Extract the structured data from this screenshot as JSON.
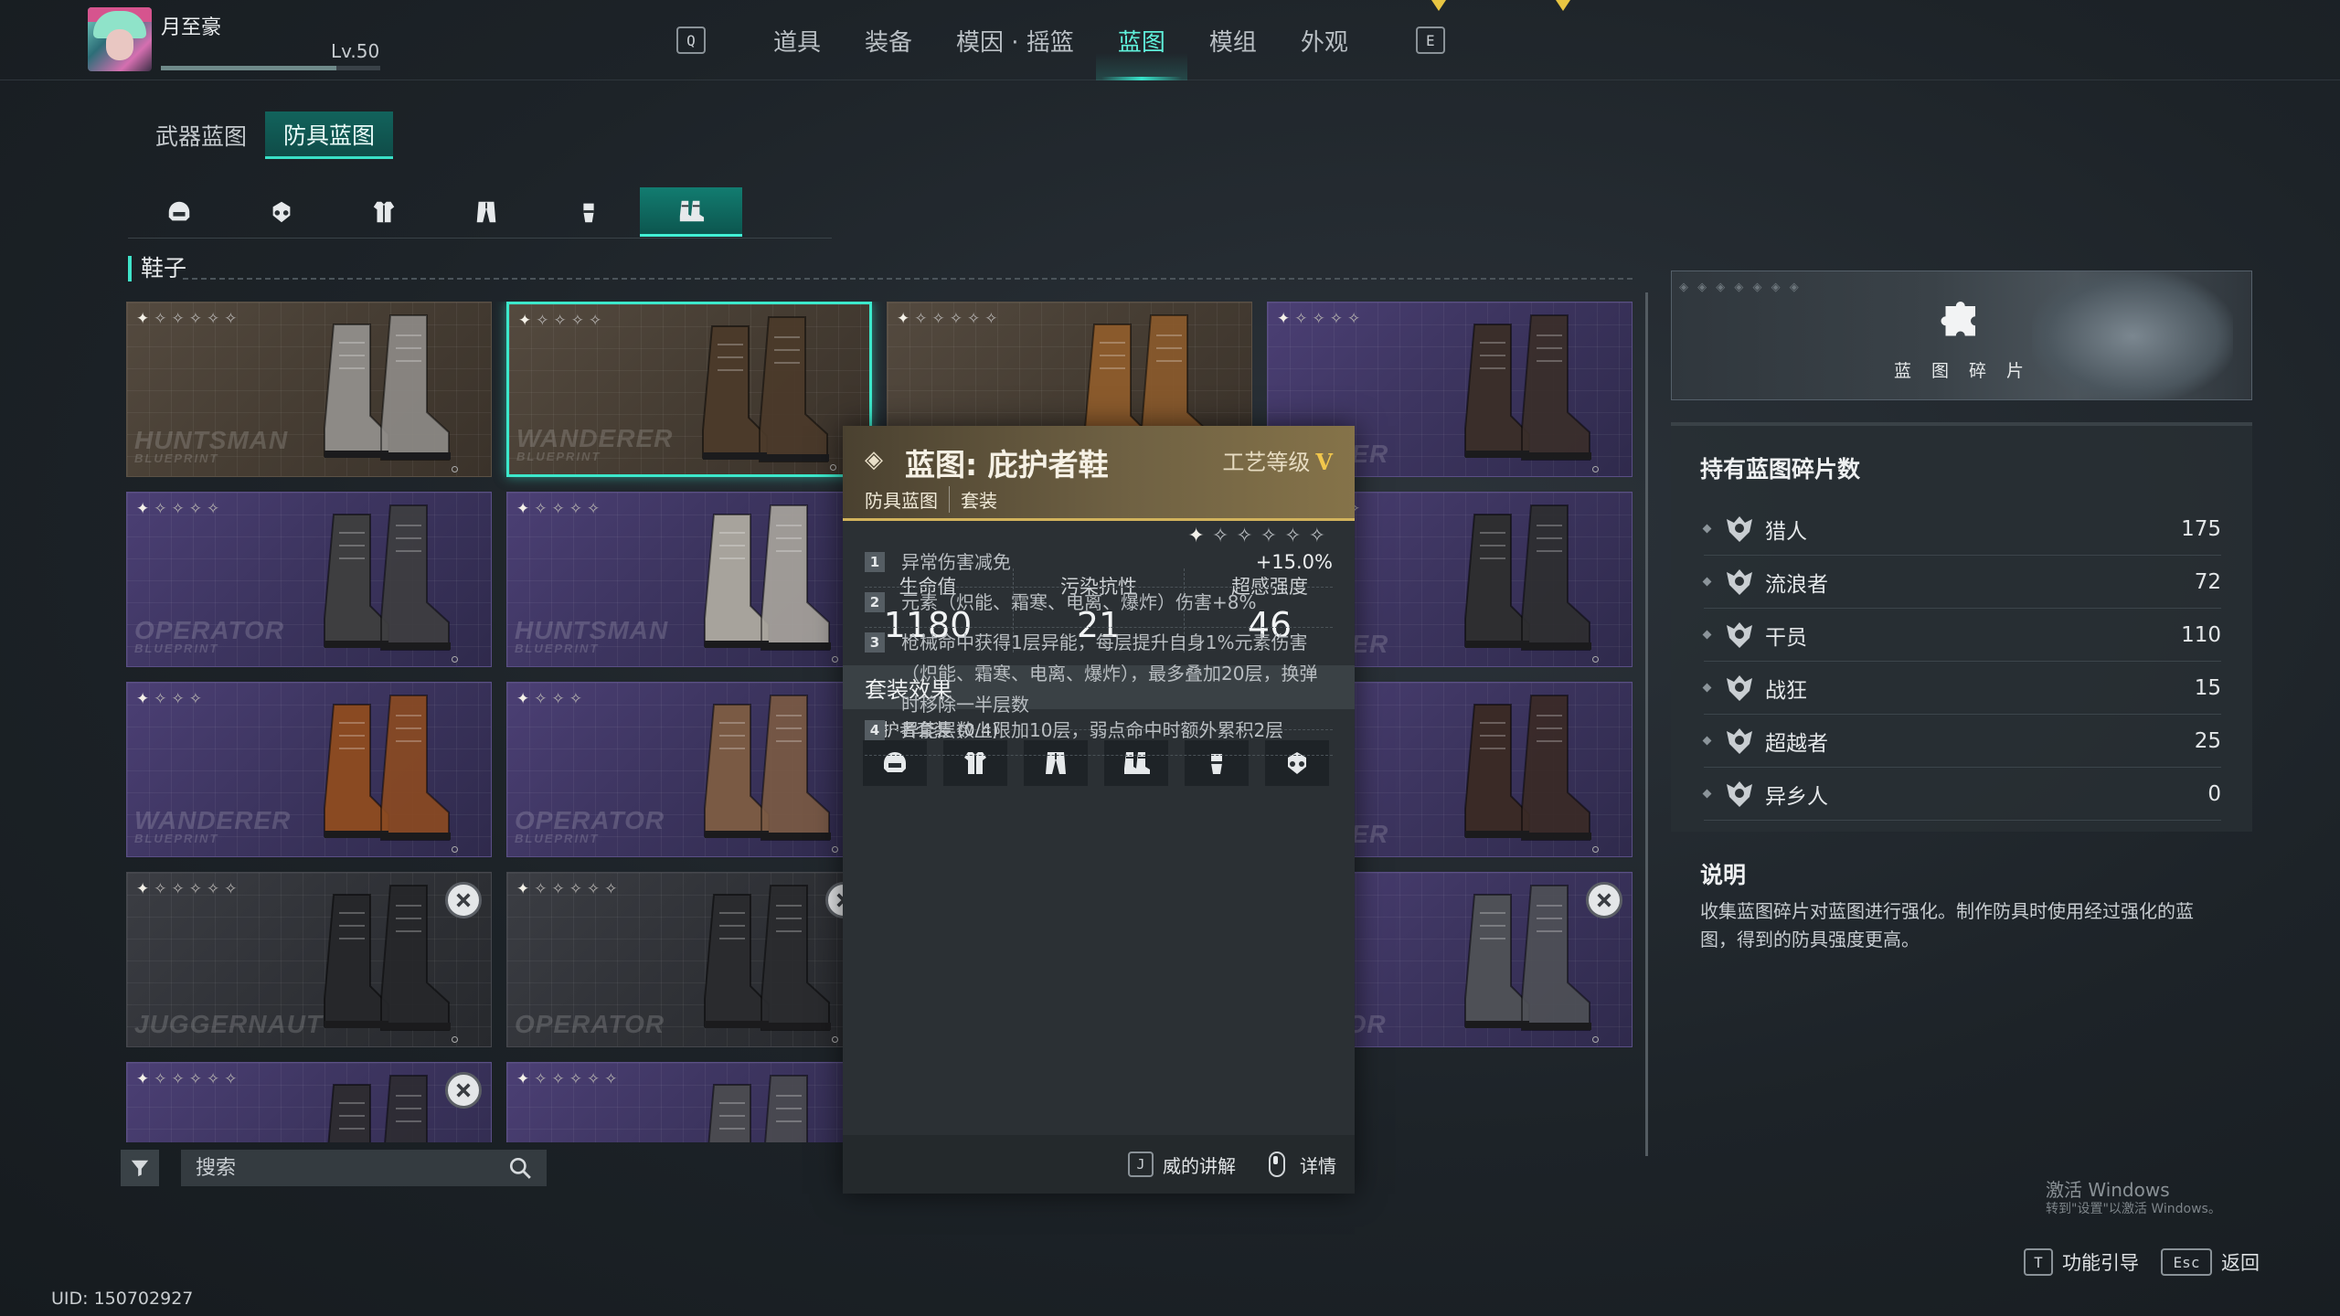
{
  "player": {
    "name": "月至豪",
    "level": "Lv.50",
    "level_progress": 0.8
  },
  "nav": {
    "left_key": "Q",
    "right_key": "E",
    "tabs": [
      "道具",
      "装备",
      "模因 · 摇篮",
      "蓝图",
      "模组",
      "外观"
    ],
    "active_tab": "蓝图"
  },
  "subtabs": [
    "武器蓝图",
    "防具蓝图"
  ],
  "active_subtab": "防具蓝图",
  "categories": [
    "helmet-icon",
    "mask-icon",
    "chest-armor-icon",
    "pants-icon",
    "gloves-icon",
    "boots-icon"
  ],
  "active_category": "boots-icon",
  "section_title": "鞋子",
  "cards": [
    {
      "brand": "HUNTSMAN",
      "sub": "BLUEPRINT",
      "stars": 6,
      "theme": "brown",
      "boot_color": "#8d8a86",
      "locked": false,
      "selected": false
    },
    {
      "brand": "WANDERER",
      "sub": "BLUEPRINT",
      "stars": 5,
      "theme": "brown",
      "boot_color": "#4b3a2a",
      "locked": false,
      "selected": true
    },
    {
      "brand": "",
      "sub": "",
      "stars": 6,
      "theme": "brown",
      "boot_color": "#8a5a2c",
      "locked": false,
      "selected": false
    },
    {
      "brand": "NDERER",
      "sub": "",
      "stars": 5,
      "theme": "purple",
      "boot_color": "#3a2e2a",
      "locked": false,
      "selected": false
    },
    {
      "brand": "OPERATOR",
      "sub": "BLUEPRINT",
      "stars": 5,
      "theme": "purple",
      "boot_color": "#3e3e40",
      "locked": false,
      "selected": false
    },
    {
      "brand": "HUNTSMAN",
      "sub": "BLUEPRINT",
      "stars": 5,
      "theme": "purple",
      "boot_color": "#a7a39c",
      "locked": false,
      "selected": false
    },
    {
      "brand": "",
      "sub": "",
      "stars": 5,
      "theme": "purple",
      "boot_color": "#4a4a3a",
      "locked": false,
      "selected": false
    },
    {
      "brand": "NDERER",
      "sub": "",
      "stars": 5,
      "theme": "purple",
      "boot_color": "#2e2e30",
      "locked": false,
      "selected": false
    },
    {
      "brand": "WANDERER",
      "sub": "BLUEPRINT",
      "stars": 4,
      "theme": "purple",
      "boot_color": "#8a4a22",
      "locked": false,
      "selected": false
    },
    {
      "brand": "OPERATOR",
      "sub": "BLUEPRINT",
      "stars": 4,
      "theme": "purple",
      "boot_color": "#7a5a44",
      "locked": false,
      "selected": false
    },
    {
      "brand": "",
      "sub": "",
      "stars": 4,
      "theme": "purple",
      "boot_color": "#5a4a40",
      "locked": false,
      "selected": false
    },
    {
      "brand": "NDERER",
      "sub": "",
      "stars": 4,
      "theme": "purple",
      "boot_color": "#3a2a26",
      "locked": false,
      "selected": false
    },
    {
      "brand": "JUGGERNAUT",
      "sub": "",
      "stars": 6,
      "theme": "grey",
      "boot_color": "#26272a",
      "locked": true,
      "selected": false
    },
    {
      "brand": "OPERATOR",
      "sub": "",
      "stars": 6,
      "theme": "grey",
      "boot_color": "#2a2b2e",
      "locked": true,
      "selected": false
    },
    {
      "brand": "",
      "sub": "",
      "stars": 6,
      "theme": "grey",
      "boot_color": "#3a3b3e",
      "locked": false,
      "selected": false
    },
    {
      "brand": "ERATOR",
      "sub": "",
      "stars": 3,
      "theme": "purple",
      "boot_color": "#4e5056",
      "locked": true,
      "selected": false
    },
    {
      "brand": "",
      "sub": "",
      "stars": 6,
      "theme": "purple",
      "boot_color": "#2e2c32",
      "locked": true,
      "selected": false
    },
    {
      "brand": "",
      "sub": "",
      "stars": 6,
      "theme": "purple",
      "boot_color": "#4a4a50",
      "locked": false,
      "selected": false
    }
  ],
  "search": {
    "placeholder": "搜索"
  },
  "uid": "UID: 150702927",
  "popup": {
    "title": "蓝图: 庇护者鞋",
    "craft_label": "工艺等级",
    "craft_level": "V",
    "tags": [
      "防具蓝图",
      "套装"
    ],
    "stars": 6,
    "stats": [
      {
        "label": "生命值",
        "value": "1180"
      },
      {
        "label": "污染抗性",
        "value": "21"
      },
      {
        "label": "超感强度",
        "value": "46"
      }
    ],
    "set_effects_title": "套装效果",
    "set_name": "庇护者套装 (0/4)",
    "set_pieces": [
      "helmet-icon",
      "chest-armor-icon",
      "pants-icon",
      "boots-icon",
      "gloves-icon",
      "mask-icon"
    ],
    "effects": [
      {
        "num": "1",
        "text": "异常伤害减免",
        "bonus": "+15.0%"
      },
      {
        "num": "2",
        "text": "元素（炽能、霜寒、电离、爆炸）伤害+8%",
        "bonus": ""
      },
      {
        "num": "3",
        "text": "枪械命中获得1层异能，每层提升自身1%元素伤害（炽能、霜寒、电离、爆炸），最多叠加20层，换弹时移除一半层数",
        "bonus": ""
      },
      {
        "num": "4",
        "text": "异能层数上限加10层，弱点命中时额外累积2层",
        "bonus": ""
      }
    ],
    "footer": {
      "key1": "J",
      "action1": "威的讲解",
      "action2": "详情"
    }
  },
  "fragments": {
    "banner_label": "蓝 图 碎 片",
    "title": "持有蓝图碎片数",
    "items": [
      {
        "name": "猎人",
        "count": "175"
      },
      {
        "name": "流浪者",
        "count": "72"
      },
      {
        "name": "干员",
        "count": "110"
      },
      {
        "name": "战狂",
        "count": "15"
      },
      {
        "name": "超越者",
        "count": "25"
      },
      {
        "name": "异乡人",
        "count": "0"
      }
    ]
  },
  "description": {
    "title": "说明",
    "text": "收集蓝图碎片对蓝图进行强化。制作防具时使用经过强化的蓝图，得到的防具强度更高。"
  },
  "watermark": {
    "line1": "激活 Windows",
    "line2": "转到\"设置\"以激活 Windows。"
  },
  "bottom_hints": [
    {
      "key": "T",
      "label": "功能引导"
    },
    {
      "key": "Esc",
      "label": "返回"
    }
  ]
}
